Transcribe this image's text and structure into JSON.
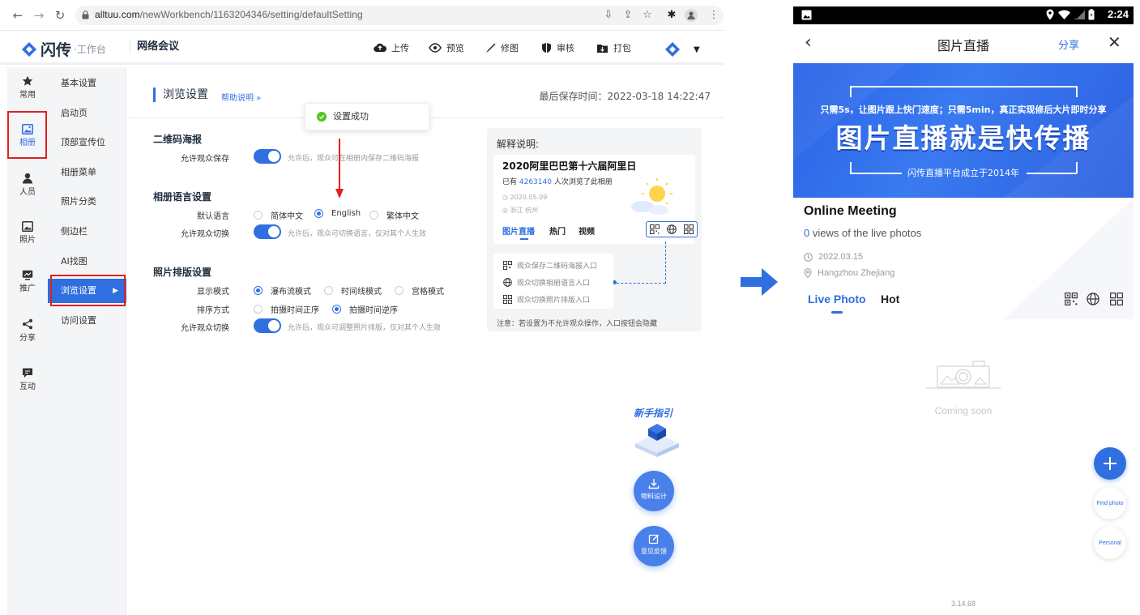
{
  "browser": {
    "url_host": "alltuu.com",
    "url_path": "/newWorkbench/1163204346/setting/defaultSetting"
  },
  "app": {
    "brand": "闪传",
    "brand_sub": "·工作台",
    "project_name": "网络会议",
    "actions": [
      "上传",
      "预览",
      "修图",
      "审核",
      "打包"
    ]
  },
  "sidebar_primary": [
    {
      "label": "常用",
      "icon": "star-icon"
    },
    {
      "label": "相册",
      "icon": "image-icon",
      "active": true
    },
    {
      "label": "人员",
      "icon": "user-icon"
    },
    {
      "label": "照片",
      "icon": "photo-icon"
    },
    {
      "label": "推广",
      "icon": "chart-icon"
    },
    {
      "label": "分享",
      "icon": "share-icon"
    },
    {
      "label": "互动",
      "icon": "chat-icon"
    }
  ],
  "sidebar_secondary": [
    "基本设置",
    "启动页",
    "顶部宣传位",
    "相册菜单",
    "照片分类",
    "侧边栏",
    "AI找图",
    "浏览设置",
    "访问设置"
  ],
  "page": {
    "title": "浏览设置",
    "help": "帮助说明 »",
    "last_saved": "最后保存时间：2022-03-18 14:22:47",
    "toast": "设置成功"
  },
  "sections": {
    "qr": {
      "title": "二维码海报",
      "label": "允许观众保存",
      "hint": "允许后，观众可在相册内保存二维码海报"
    },
    "lang": {
      "title": "相册语言设置",
      "default_label": "默认语言",
      "options": [
        "简体中文",
        "English",
        "繁体中文"
      ],
      "selected": "English",
      "switch_label": "允许观众切换",
      "switch_hint": "允许后，观众可切换语言，仅对其个人生效"
    },
    "layout": {
      "title": "照片排版设置",
      "mode_label": "显示模式",
      "mode_options": [
        "瀑布流模式",
        "时间线模式",
        "宫格模式"
      ],
      "mode_selected": "瀑布流模式",
      "sort_label": "排序方式",
      "sort_options": [
        "拍摄时间正序",
        "拍摄时间逆序"
      ],
      "sort_selected": "拍摄时间逆序",
      "switch_label": "允许观众切换",
      "switch_hint": "允许后，观众可调整照片排版，仅对其个人生效"
    }
  },
  "explain": {
    "title": "解释说明:",
    "card_title": "2020阿里巴巴第十六届阿里日",
    "views_prefix": "已有 ",
    "views_num": "4263140",
    "views_suffix": " 人次浏览了此相册",
    "date": "2020.05.09",
    "location": "浙江 杭州",
    "tabs": [
      "图片直播",
      "热门",
      "视频"
    ],
    "list": [
      "观众保存二维码海报入口",
      "观众切换相册语言入口",
      "观众切换照片排版入口"
    ],
    "note": "注意：若设置为不允许观众操作，入口按钮会隐藏"
  },
  "floating": {
    "guide": "新手指引",
    "material": "物料设计",
    "feedback": "意见反馈"
  },
  "phone": {
    "time": "2:24",
    "title": "图片直播",
    "share": "分享",
    "banner_sub": "只需5s，让图片跟上快门速度；只需5min，真正实现修后大片即时分享",
    "banner_main": "图片直播就是快传播",
    "banner_foot": "闪传直播平台成立于2014年",
    "album_title": "Online Meeting",
    "views_num": "0",
    "views_text": " views of the live photos",
    "date": "2022.03.15",
    "location": "Hangzhou Zhejiang",
    "tabs": [
      "Live Photo",
      "Hot"
    ],
    "empty": "Coming soon",
    "fab_find": "Find photo",
    "fab_personal": "Personal",
    "version": "3.14.68"
  },
  "colors": {
    "accent": "#2f6fe0",
    "highlight": "#e02020"
  }
}
